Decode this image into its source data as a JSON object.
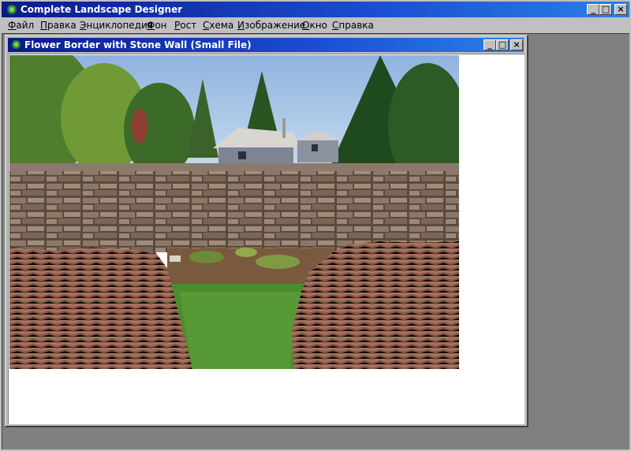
{
  "app": {
    "title": "Complete Landscape Designer"
  },
  "menu": [
    {
      "label": "Файл",
      "hotkey": "Ф",
      "rest": "айл"
    },
    {
      "label": "Правка",
      "hotkey": "П",
      "rest": "равка"
    },
    {
      "label": "Энциклопедия",
      "hotkey": "Э",
      "rest": "нциклопедия"
    },
    {
      "label": "Фон",
      "hotkey": "Ф",
      "rest": "он"
    },
    {
      "label": "Рост",
      "hotkey": "Р",
      "rest": "ост"
    },
    {
      "label": "Схема",
      "hotkey": "С",
      "rest": "хема"
    },
    {
      "label": "Изображение",
      "hotkey": "И",
      "rest": "зображение"
    },
    {
      "label": "Окно",
      "hotkey": "О",
      "rest": "кно"
    },
    {
      "label": "Справка",
      "hotkey": "С",
      "rest": "правка"
    }
  ],
  "document": {
    "title": "Flower Border with Stone Wall  (Small File)"
  },
  "window_buttons": {
    "minimize": "_",
    "maximize": "□",
    "close": "×"
  },
  "scene_description_icons": [
    "trees",
    "houses",
    "stone-wall",
    "flower-bed",
    "lawn",
    "brick-paving"
  ],
  "colors": {
    "titlebar_start": "#0a1a8c",
    "titlebar_end": "#2a80e8",
    "workspace": "#808080",
    "chrome": "#c0c0c0"
  }
}
